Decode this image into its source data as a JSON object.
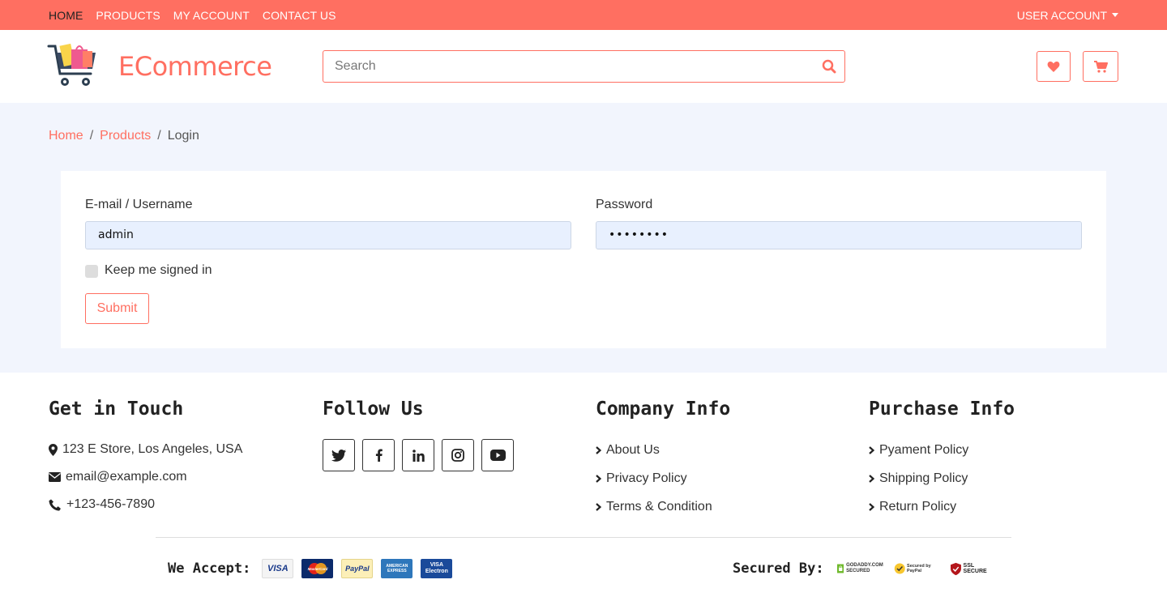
{
  "topnav": {
    "items": [
      "HOME",
      "PRODUCTS",
      "MY ACCOUNT",
      "CONTACT US"
    ],
    "user_account": "USER ACCOUNT"
  },
  "header": {
    "brand": "ECommerce",
    "search_placeholder": "Search"
  },
  "breadcrumb": {
    "items": [
      "Home",
      "Products",
      "Login"
    ],
    "separator": "/"
  },
  "login": {
    "email_label": "E-mail / Username",
    "email_value": "admin",
    "password_label": "Password",
    "password_value": "••••••••",
    "remember_label": "Keep me signed in",
    "submit_label": "Submit"
  },
  "footer": {
    "contact": {
      "heading": "Get in Touch",
      "address": "123 E Store, Los Angeles, USA",
      "email": "email@example.com",
      "phone": "+123-456-7890"
    },
    "follow": {
      "heading": "Follow Us",
      "icons": [
        "twitter-icon",
        "facebook-icon",
        "linkedin-icon",
        "instagram-icon",
        "youtube-icon"
      ]
    },
    "company": {
      "heading": "Company Info",
      "links": [
        "About Us",
        "Privacy Policy",
        "Terms & Condition"
      ]
    },
    "purchase": {
      "heading": "Purchase Info",
      "links": [
        "Pyament Policy",
        "Shipping Policy",
        "Return Policy"
      ]
    },
    "accept_label": "We Accept:",
    "payment_logos": [
      "VISA",
      "MasterCard",
      "PayPal",
      "AMERICAN EXPRESS",
      "VISA Electron"
    ],
    "secured_label": "Secured By:",
    "seal_logos": [
      "GODADDY.COM SECURED",
      "Secured by PayPal",
      "SSL SECURE"
    ]
  },
  "colors": {
    "accent": "#ff6f61",
    "page_bg": "#f2f5fd",
    "input_bg": "#e8f0fe"
  }
}
